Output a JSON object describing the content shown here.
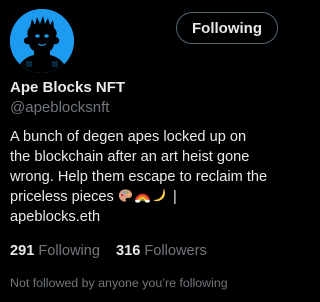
{
  "profile": {
    "display_name": "Ape Blocks NFT",
    "handle": "@apeblocksnft",
    "bio_lines": [
      "A bunch of degen apes locked up on",
      "the blockchain after an art heist gone",
      "wrong. Help them escape to reclaim the",
      "priceless pieces",
      "apeblocks.eth"
    ],
    "bio_separator": "|",
    "bio_emojis": [
      "artist-palette-emoji",
      "rainbow-emoji",
      "banana-emoji"
    ],
    "avatar_color": "#1d9bf0"
  },
  "follow_button": {
    "label": "Following"
  },
  "stats": {
    "following_count": "291",
    "following_label": "Following",
    "followers_count": "316",
    "followers_label": "Followers"
  },
  "social_context": {
    "text": "Not followed by anyone you’re following"
  },
  "colors": {
    "background": "#000000",
    "primary_text": "#e7e9ea",
    "secondary_text": "#71767b",
    "button_border": "#536471",
    "accent": "#1d9bf0"
  }
}
